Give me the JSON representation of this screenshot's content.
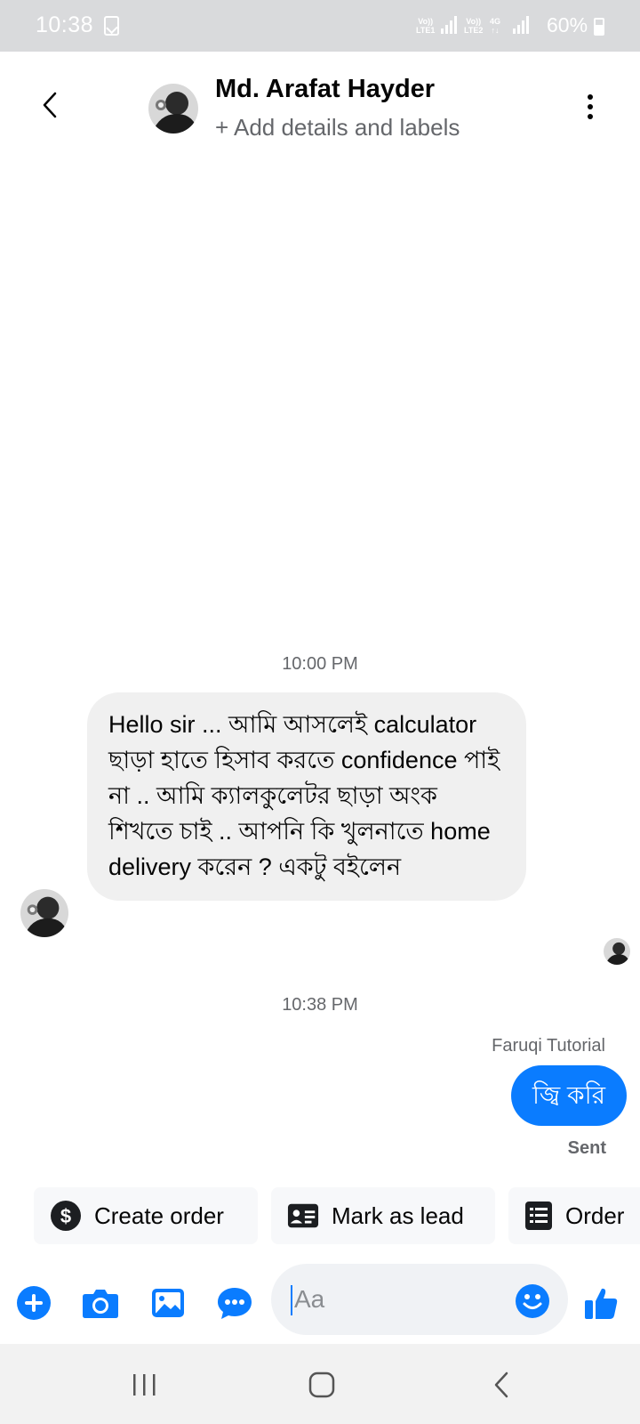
{
  "status_bar": {
    "time": "10:38",
    "sim1_top": "Vo))",
    "sim1_bottom": "LTE1",
    "sim2_top": "Vo))",
    "sim2_bottom": "LTE2",
    "network": "4G",
    "battery": "60%"
  },
  "header": {
    "contact_name": "Md. Arafat Hayder",
    "subtitle": "+ Add details and labels"
  },
  "messages": {
    "timestamp_1": "10:00 PM",
    "incoming_text": "Hello sir ... আমি আসলেই calculator ছাড়া হাতে হিসাব করতে confidence পাই না .. আমি ক্যালকুলেটর ছাড়া অংক শিখতে চাই .. আপনি কি খুলনাতে home delivery করেন ? একটু বইলেন",
    "timestamp_2": "10:38 PM",
    "outgoing_sender": "Faruqi Tutorial",
    "outgoing_text": "জ্বি করি",
    "outgoing_status": "Sent"
  },
  "quick_actions": [
    {
      "label": "Create order",
      "icon": "dollar-icon"
    },
    {
      "label": "Mark as lead",
      "icon": "id-card-icon"
    },
    {
      "label": "Order",
      "icon": "list-doc-icon"
    }
  ],
  "composer": {
    "placeholder": "Aa"
  },
  "colors": {
    "accent": "#0a7cff",
    "incoming_bubble": "#f0f0f0",
    "secondary_text": "#65676b"
  }
}
